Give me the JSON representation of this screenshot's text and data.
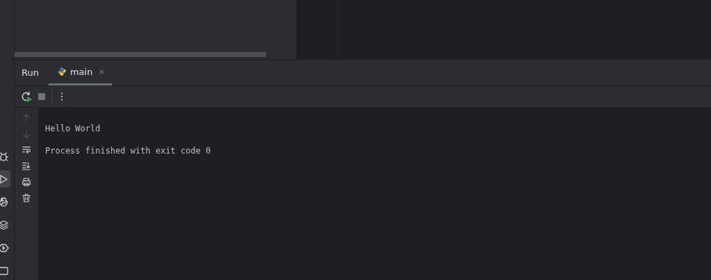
{
  "tool_stripe": [
    {
      "kind": "debug",
      "selected": false
    },
    {
      "kind": "run",
      "selected": true
    },
    {
      "kind": "python-console",
      "selected": false
    },
    {
      "kind": "layers",
      "selected": false
    },
    {
      "kind": "services",
      "selected": false
    },
    {
      "kind": "terminal",
      "selected": false
    }
  ],
  "run_panel": {
    "title": "Run",
    "tabs": [
      {
        "label": "main",
        "selected": true
      }
    ],
    "toolbar": [
      {
        "kind": "rerun"
      },
      {
        "kind": "stop"
      },
      {
        "kind": "more"
      }
    ],
    "gutter": [
      {
        "kind": "up",
        "disabled": true
      },
      {
        "kind": "down",
        "disabled": true
      },
      {
        "kind": "wrap",
        "disabled": false
      },
      {
        "kind": "scroll-end",
        "disabled": false
      },
      {
        "kind": "print",
        "disabled": false
      },
      {
        "kind": "clear",
        "disabled": false
      }
    ],
    "console": [
      {
        "kind": "output",
        "text": "Hello World"
      },
      {
        "kind": "exit",
        "text": "Process finished with exit code 0"
      }
    ]
  }
}
